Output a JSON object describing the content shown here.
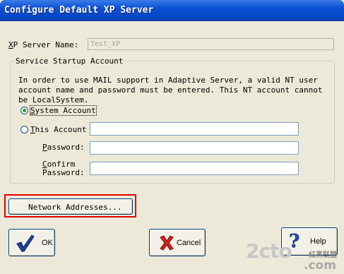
{
  "window": {
    "title": "Configure Default XP Server"
  },
  "server": {
    "name_label_hotkey": "X",
    "name_label_rest": "P Server Name:",
    "name_value": "Test_XP"
  },
  "service": {
    "group_label": "Service Startup Account",
    "description": "In order to use MAIL support in Adaptive Server, a valid NT user account name and password must be entered. This NT account cannot be LocalSystem.",
    "system_account_hotkey": "S",
    "system_account_rest": "ystem Account",
    "this_account_hotkey": "T",
    "this_account_rest": "his Account",
    "password_hotkey": "P",
    "password_rest": "assword:",
    "confirm_line1_hotkey": "C",
    "confirm_line1_rest": "onfirm",
    "confirm_line2": "Password:",
    "selected": "system_account"
  },
  "buttons": {
    "network_addresses": "Network Addresses...",
    "ok": "OK",
    "cancel": "Cancel",
    "help": "Help"
  },
  "watermark": {
    "logo": "2cto",
    "suffix": ".com",
    "cn": "红黑联盟"
  },
  "colors": {
    "titlebar": "#0a4fd4",
    "highlight_box": "#e30000",
    "ok_check": "#1f3f99",
    "cancel_x": "#d42020",
    "help_question": "#1c4fb3"
  }
}
